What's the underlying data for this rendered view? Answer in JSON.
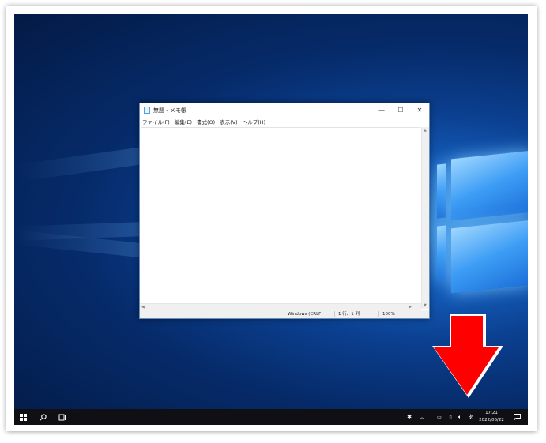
{
  "window": {
    "title": "無題 - メモ帳",
    "controls": {
      "minimize": "—",
      "maximize": "☐",
      "close": "✕"
    }
  },
  "menu": [
    "ファイル(F)",
    "編集(E)",
    "書式(O)",
    "表示(V)",
    "ヘルプ(H)"
  ],
  "editor": {
    "content": ""
  },
  "status": {
    "encoding": "Windows (CRLF)",
    "position": "1 行、1 列",
    "zoom": "100%"
  },
  "taskbar": {
    "time": "17:21",
    "date": "2022/06/22",
    "ime": "あ"
  },
  "colors": {
    "arrow": "#ff0000",
    "taskbar": "#101014",
    "desktop_accent": "#1560c0"
  }
}
